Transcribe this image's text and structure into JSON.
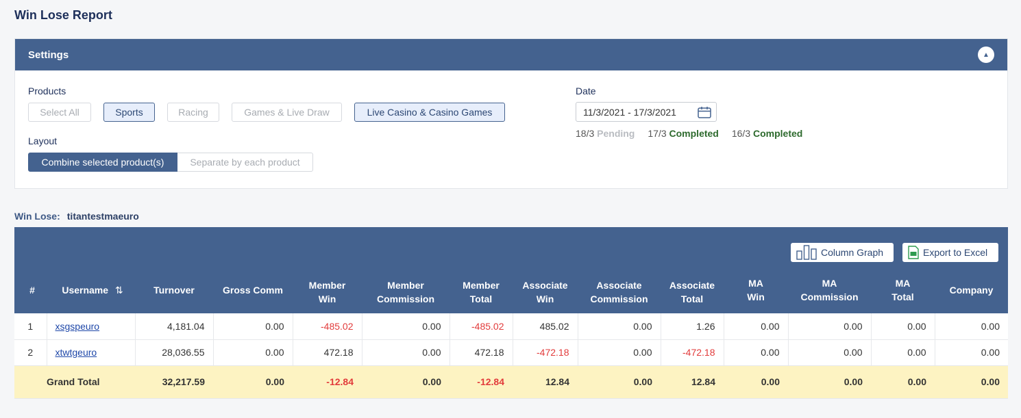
{
  "page_title": "Win Lose Report",
  "settings": {
    "header": "Settings",
    "collapse_icon": "chevron-up-icon",
    "products_label": "Products",
    "products": [
      {
        "label": "Select All",
        "selected": false
      },
      {
        "label": "Sports",
        "selected": true
      },
      {
        "label": "Racing",
        "selected": false
      },
      {
        "label": "Games & Live Draw",
        "selected": false
      },
      {
        "label": "Live Casino & Casino Games",
        "selected": true
      }
    ],
    "layout_label": "Layout",
    "layout_options": [
      "Combine selected product(s)",
      "Separate by each product"
    ],
    "date_label": "Date",
    "date_value": "11/3/2021 - 17/3/2021",
    "date_status": [
      {
        "date": "18/3",
        "status": "Pending"
      },
      {
        "date": "17/3",
        "status": "Completed"
      },
      {
        "date": "16/3",
        "status": "Completed"
      }
    ]
  },
  "winlose": {
    "label": "Win Lose:",
    "account": "titantestmaeuro"
  },
  "toolbar": {
    "column_graph": "Column Graph",
    "export_excel": "Export to Excel"
  },
  "columns": [
    [
      "#"
    ],
    [
      "Username"
    ],
    [
      "Turnover"
    ],
    [
      "Gross Comm"
    ],
    [
      "Member",
      "Win"
    ],
    [
      "Member",
      "Commission"
    ],
    [
      "Member",
      "Total"
    ],
    [
      "Associate",
      "Win"
    ],
    [
      "Associate",
      "Commission"
    ],
    [
      "Associate",
      "Total"
    ],
    [
      "MA",
      "Win"
    ],
    [
      "MA",
      "Commission"
    ],
    [
      "MA",
      "Total"
    ],
    [
      "Company"
    ]
  ],
  "rows": [
    {
      "no": "1",
      "username": "xsgspeuro",
      "turnover": "4,181.04",
      "gross_comm": "0.00",
      "member_win": "-485.02",
      "member_comm": "0.00",
      "member_total": "-485.02",
      "assoc_win": "485.02",
      "assoc_comm": "0.00",
      "assoc_total": "1.26",
      "ma_win": "0.00",
      "ma_comm": "0.00",
      "ma_total": "0.00",
      "company": "0.00"
    },
    {
      "no": "2",
      "username": "xtwtgeuro",
      "turnover": "28,036.55",
      "gross_comm": "0.00",
      "member_win": "472.18",
      "member_comm": "0.00",
      "member_total": "472.18",
      "assoc_win": "-472.18",
      "assoc_comm": "0.00",
      "assoc_total": "-472.18",
      "ma_win": "0.00",
      "ma_comm": "0.00",
      "ma_total": "0.00",
      "company": "0.00"
    }
  ],
  "grand_total": {
    "label": "Grand Total",
    "turnover": "32,217.59",
    "gross_comm": "0.00",
    "member_win": "-12.84",
    "member_comm": "0.00",
    "member_total": "-12.84",
    "assoc_win": "12.84",
    "assoc_comm": "0.00",
    "assoc_total": "12.84",
    "ma_win": "0.00",
    "ma_comm": "0.00",
    "ma_total": "0.00",
    "company": "0.00"
  },
  "colors": {
    "header_blue": "#44628f",
    "negative": "#e23b3b",
    "grand_total_bg": "#fdf3c2",
    "completed": "#2d6a2d",
    "pending": "#b9bcc1"
  }
}
